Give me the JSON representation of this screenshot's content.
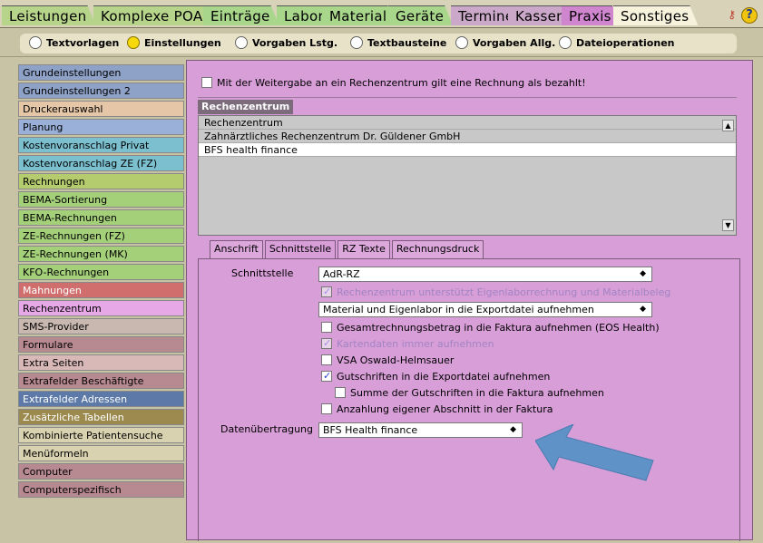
{
  "top_tabs": [
    {
      "label": "Leistungen",
      "color": "#b6d48a"
    },
    {
      "label": "Komplexe POA",
      "color": "#b6d48a"
    },
    {
      "label": "Einträge",
      "color": "#a8d68a"
    },
    {
      "label": "Labor",
      "color": "#a8d68a"
    },
    {
      "label": "Material",
      "color": "#a8d68a"
    },
    {
      "label": "Geräte",
      "color": "#a8d68a"
    },
    {
      "label": "Termine",
      "color": "#cba8c9"
    },
    {
      "label": "Kassen",
      "color": "#cba8c9"
    },
    {
      "label": "Praxis",
      "color": "#cf86cf"
    },
    {
      "label": "Sonstiges",
      "color": "#f6f2dc"
    }
  ],
  "sub_tabs": [
    {
      "label": "Textvorlagen",
      "selected": false
    },
    {
      "label": "Einstellungen",
      "selected": true
    },
    {
      "label": "Vorgaben Lstg.",
      "selected": false
    },
    {
      "label": "Textbausteine",
      "selected": false
    },
    {
      "label": "Vorgaben Allg.",
      "selected": false
    },
    {
      "label": "Dateioperationen",
      "selected": false
    }
  ],
  "left_menu": [
    {
      "label": "Grundeinstellungen",
      "color": "#8ea1c6"
    },
    {
      "label": "Grundeinstellungen 2",
      "color": "#8ea1c6"
    },
    {
      "label": "Druckerauswahl",
      "color": "#e5c6a6"
    },
    {
      "label": "Planung",
      "color": "#9ab0d8"
    },
    {
      "label": "Kostenvoranschlag Privat",
      "color": "#7cc0cf"
    },
    {
      "label": "Kostenvoranschlag ZE (FZ)",
      "color": "#7cc0cf"
    },
    {
      "label": "Rechnungen",
      "color": "#b4cc6e"
    },
    {
      "label": "BEMA-Sortierung",
      "color": "#a5d07a"
    },
    {
      "label": "BEMA-Rechnungen",
      "color": "#a5d07a"
    },
    {
      "label": "ZE-Rechnungen (FZ)",
      "color": "#a5d07a"
    },
    {
      "label": "ZE-Rechnungen (MK)",
      "color": "#a5d07a"
    },
    {
      "label": "KFO-Rechnungen",
      "color": "#a5d07a"
    },
    {
      "label": "Mahnungen",
      "color": "#d06e6e"
    },
    {
      "label": "Rechenzentrum",
      "color": "#e6a8e6"
    },
    {
      "label": "SMS-Provider",
      "color": "#c8b8b0"
    },
    {
      "label": "Formulare",
      "color": "#b78a92"
    },
    {
      "label": "Extra Seiten",
      "color": "#d9b8b8"
    },
    {
      "label": "Extrafelder Beschäftigte",
      "color": "#b78a92"
    },
    {
      "label": "Extrafelder Adressen",
      "color": "#5c79a8"
    },
    {
      "label": "Zusätzliche Tabellen",
      "color": "#9c8a4e"
    },
    {
      "label": "Kombinierte Patientensuche",
      "color": "#d9d2b0"
    },
    {
      "label": "Menüformeln",
      "color": "#d9d2b0"
    },
    {
      "label": "Computer",
      "color": "#b78a92"
    },
    {
      "label": "Computerspezifisch",
      "color": "#b78a92"
    }
  ],
  "main": {
    "paid_checkbox_label": "Mit der Weitergabe an ein Rechenzentrum gilt eine Rechnung als bezahlt!",
    "section_title": "Rechenzentrum",
    "rz_list": [
      "Rechenzentrum",
      "Zahnärztliches Rechenzentrum Dr. Güldener GmbH",
      "BFS health finance"
    ],
    "tabs": [
      "Anschrift",
      "Schnittstelle",
      "RZ Texte",
      "Rechnungsdruck"
    ],
    "schnittstelle_label": "Schnittstelle",
    "schnittstelle_value": "AdR-RZ",
    "opt_eigenlabor": "Rechenzentrum unterstützt Eigenlaborrechnung und Materialbeleg",
    "material_select": "Material und Eigenlabor in die Exportdatei aufnehmen",
    "opt_gesamt": "Gesamtrechnungsbetrag in die Faktura aufnehmen (EOS Health)",
    "opt_karten": "Kartendaten immer aufnehmen",
    "opt_vsa": "VSA Oswald-Helmsauer",
    "opt_gutschriften": "Gutschriften in die Exportdatei aufnehmen",
    "opt_summe": "Summe der Gutschriften in die Faktura aufnehmen",
    "opt_anzahlung": "Anzahlung eigener Abschnitt in der Faktura",
    "datenuebertragung_label": "Datenübertragung",
    "datenuebertragung_value": "BFS Health finance"
  }
}
